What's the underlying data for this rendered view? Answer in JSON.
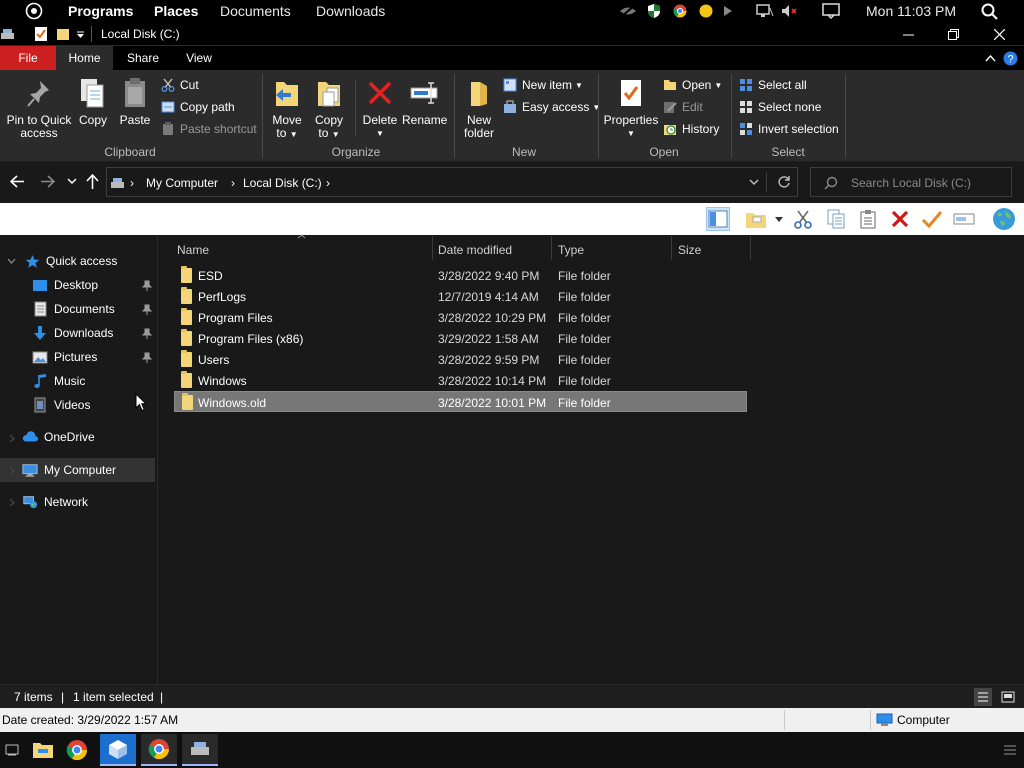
{
  "top_panel": {
    "menus": [
      "Programs",
      "Places",
      "Documents",
      "Downloads"
    ],
    "clock": "Mon 11:03 PM"
  },
  "window": {
    "title": "Local Disk (C:)"
  },
  "ribbon": {
    "tabs": [
      "File",
      "Home",
      "Share",
      "View"
    ],
    "clipboard": {
      "pin": "Pin to Quick access",
      "pin_line1": "Pin to Quick",
      "pin_line2": "access",
      "copy": "Copy",
      "paste": "Paste",
      "cut": "Cut",
      "copy_path": "Copy path",
      "paste_shortcut": "Paste shortcut",
      "label": "Clipboard"
    },
    "organize": {
      "move_to_1": "Move",
      "move_to_2": "to",
      "copy_to_1": "Copy",
      "copy_to_2": "to",
      "delete": "Delete",
      "rename": "Rename",
      "label": "Organize"
    },
    "new": {
      "new_folder_1": "New",
      "new_folder_2": "folder",
      "new_item": "New item",
      "easy_access": "Easy access",
      "label": "New"
    },
    "open": {
      "properties": "Properties",
      "open": "Open",
      "edit": "Edit",
      "history": "History",
      "label": "Open"
    },
    "select": {
      "select_all": "Select all",
      "select_none": "Select none",
      "invert": "Invert selection",
      "label": "Select"
    }
  },
  "address": {
    "crumbs": [
      "My Computer",
      "Local Disk (C:)"
    ],
    "search_placeholder": "Search Local Disk (C:)"
  },
  "nav_pane": {
    "quick_access": "Quick access",
    "items": [
      "Desktop",
      "Documents",
      "Downloads",
      "Pictures",
      "Music",
      "Videos"
    ],
    "onedrive": "OneDrive",
    "my_computer": "My Computer",
    "network": "Network"
  },
  "file_list": {
    "columns": [
      "Name",
      "Date modified",
      "Type",
      "Size"
    ],
    "rows": [
      {
        "name": "ESD",
        "date": "3/28/2022 9:40 PM",
        "type": "File folder"
      },
      {
        "name": "PerfLogs",
        "date": "12/7/2019 4:14 AM",
        "type": "File folder"
      },
      {
        "name": "Program Files",
        "date": "3/28/2022 10:29 PM",
        "type": "File folder"
      },
      {
        "name": "Program Files (x86)",
        "date": "3/29/2022 1:58 AM",
        "type": "File folder"
      },
      {
        "name": "Users",
        "date": "3/28/2022 9:59 PM",
        "type": "File folder"
      },
      {
        "name": "Windows",
        "date": "3/28/2022 10:14 PM",
        "type": "File folder"
      },
      {
        "name": "Windows.old",
        "date": "3/28/2022 10:01 PM",
        "type": "File folder"
      }
    ],
    "selected_index": 6
  },
  "status": {
    "items": "7 items",
    "selected": "1 item selected",
    "sep": "|"
  },
  "details": {
    "created": "Date created: 3/29/2022 1:57 AM",
    "location": "Computer"
  },
  "colors": {
    "file_tab": "#cc1f1f",
    "selection": "#777777",
    "folder": "#f4d57a"
  }
}
